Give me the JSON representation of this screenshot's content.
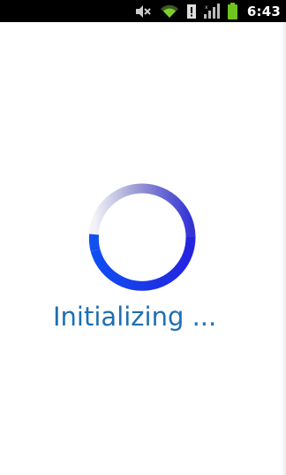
{
  "status_bar": {
    "time": "6:43",
    "icons": [
      "mute-icon",
      "wifi-icon",
      "alert-icon",
      "signal-icon",
      "battery-icon"
    ]
  },
  "main": {
    "message": "Initializing ..."
  },
  "colors": {
    "status_bar_bg": "#000000",
    "background": "#ffffff",
    "label_text": "#1e6fb3",
    "spinner_blue": "#1a3cf0",
    "wifi_green": "#7dcf2a",
    "battery_green": "#6fc41f"
  }
}
